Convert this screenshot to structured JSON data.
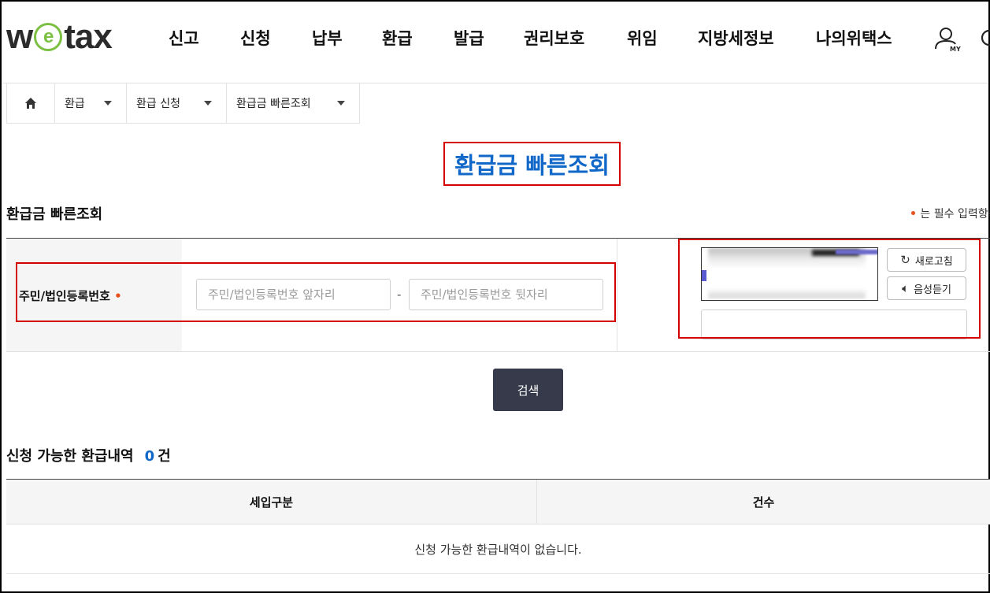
{
  "header": {
    "logo": {
      "pre": "w",
      "mid": "e",
      "post": "tax"
    },
    "nav": [
      "신고",
      "신청",
      "납부",
      "환급",
      "발급",
      "권리보호",
      "위임",
      "지방세정보",
      "나의위택스"
    ],
    "my_label": "MY",
    "icons": [
      "user-my-icon",
      "search-icon"
    ]
  },
  "breadcrumb": {
    "home_icon": "home-icon",
    "items": [
      "환급",
      "환급 신청",
      "환급금 빠른조회"
    ]
  },
  "page": {
    "title": "환급금 빠른조회",
    "section_title": "환급금 빠른조회",
    "required_note": {
      "dot": "•",
      "text": "는 필수 입력항목입니다"
    }
  },
  "form": {
    "id_label": "주민/법인등록번호",
    "required_dot": "•",
    "front_placeholder": "주민/법인등록번호 앞자리",
    "back_placeholder": "주민/법인등록번호 뒷자리",
    "separator": "-",
    "captcha": {
      "refresh_label": "새로고침",
      "audio_label": "음성듣기",
      "input_value": ""
    },
    "search_button": "검색"
  },
  "results": {
    "title": "신청 가능한 환급내역",
    "count": "0",
    "unit": "건",
    "columns": [
      "세입구분",
      "건수"
    ],
    "empty_message": "신청 가능한 환급내역이 없습니다."
  },
  "colors": {
    "accent_blue": "#1268c8",
    "highlight_red": "#d40000",
    "required_orange": "#e8501c",
    "button_dark": "#363a4a",
    "logo_green": "#7bc043"
  }
}
